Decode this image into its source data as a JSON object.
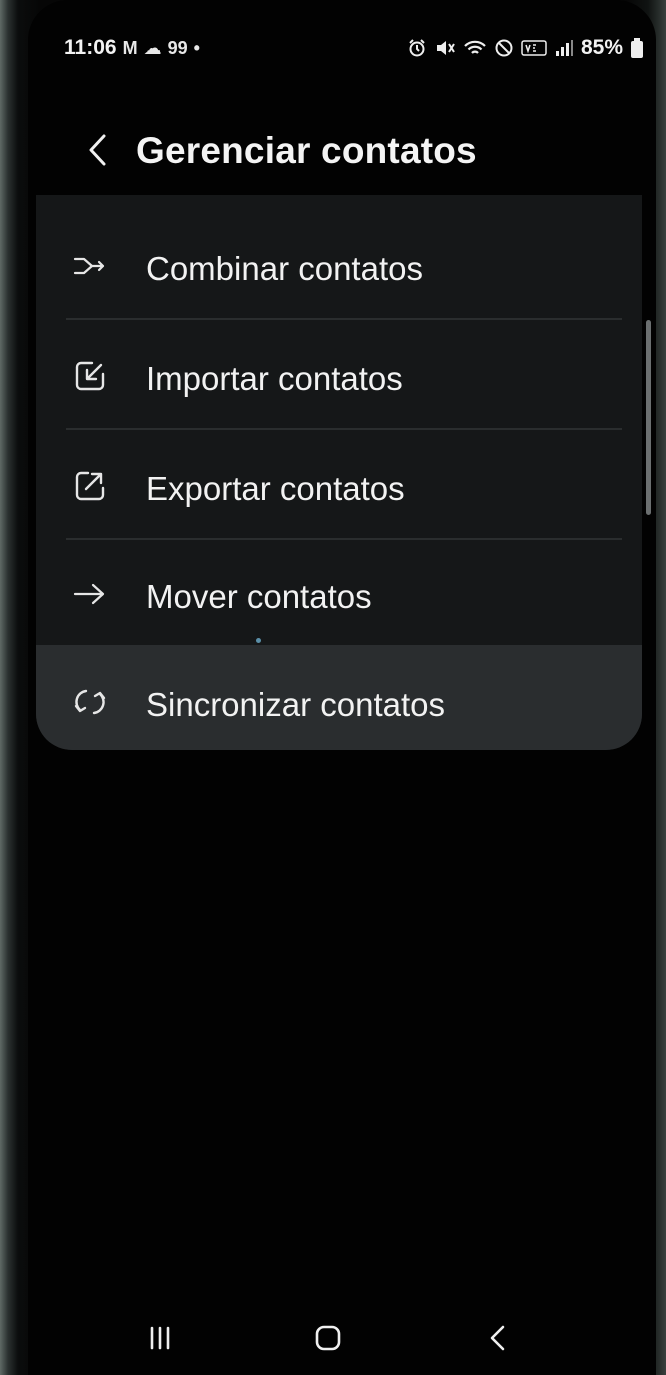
{
  "status_bar": {
    "time": "11:06",
    "left_icons": [
      "M",
      "☁",
      "99",
      "•"
    ],
    "battery": "85%"
  },
  "header": {
    "title": "Gerenciar contatos"
  },
  "menu": {
    "items": [
      {
        "label": "Combinar contatos",
        "icon": "merge-icon"
      },
      {
        "label": "Importar contatos",
        "icon": "import-icon"
      },
      {
        "label": "Exportar contatos",
        "icon": "export-icon"
      },
      {
        "label": "Mover contatos",
        "icon": "arrow-right-icon"
      },
      {
        "label": "Sincronizar contatos",
        "icon": "sync-icon"
      }
    ]
  },
  "colors": {
    "background": "#020202",
    "card": "#151718",
    "highlight": "#2a2d2f",
    "text": "#f2f2f2"
  }
}
